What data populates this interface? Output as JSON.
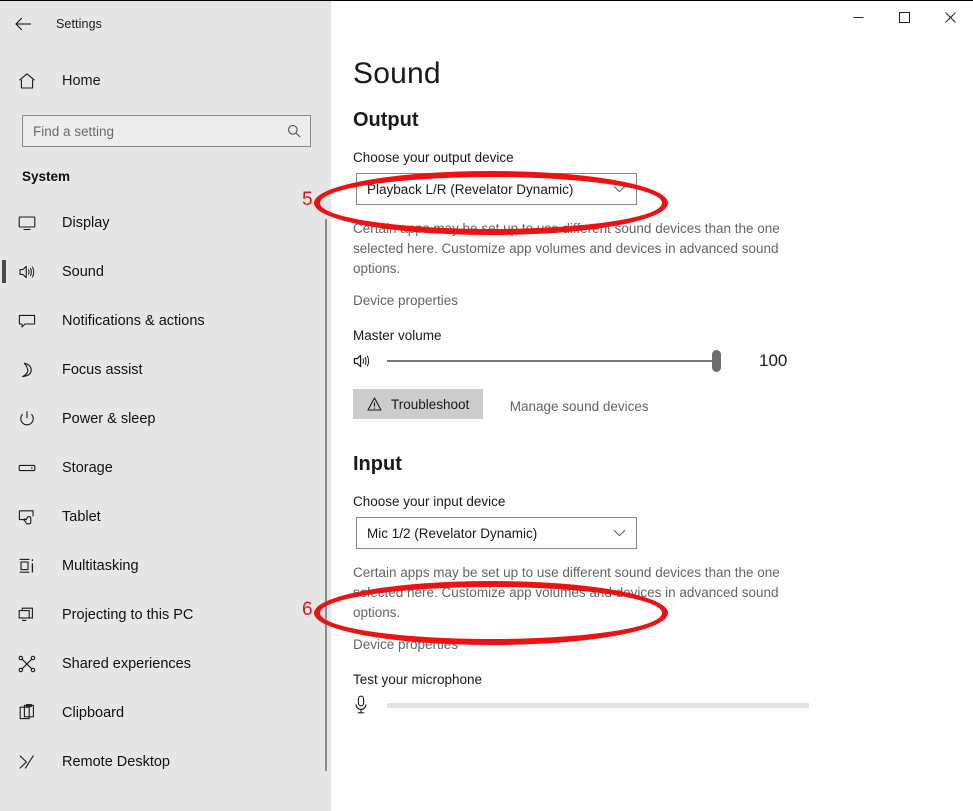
{
  "window": {
    "title": "Settings",
    "back_icon": "back-arrow-icon",
    "minimize_label": "–",
    "maximize_label": "□",
    "close_label": "×"
  },
  "sidebar": {
    "home_label": "Home",
    "home_icon": "home-icon",
    "search": {
      "placeholder": "Find a setting",
      "value": "",
      "icon": "search-icon"
    },
    "section_label": "System",
    "items": [
      {
        "label": "Display",
        "icon": "monitor-icon",
        "selected": false
      },
      {
        "label": "Sound",
        "icon": "speaker-icon",
        "selected": true
      },
      {
        "label": "Notifications & actions",
        "icon": "notification-icon",
        "selected": false
      },
      {
        "label": "Focus assist",
        "icon": "moon-icon",
        "selected": false
      },
      {
        "label": "Power & sleep",
        "icon": "power-icon",
        "selected": false
      },
      {
        "label": "Storage",
        "icon": "drive-icon",
        "selected": false
      },
      {
        "label": "Tablet",
        "icon": "tablet-icon",
        "selected": false
      },
      {
        "label": "Multitasking",
        "icon": "multitasking-icon",
        "selected": false
      },
      {
        "label": "Projecting to this PC",
        "icon": "projecting-icon",
        "selected": false
      },
      {
        "label": "Shared experiences",
        "icon": "share-icon",
        "selected": false
      },
      {
        "label": "Clipboard",
        "icon": "clipboard-icon",
        "selected": false
      },
      {
        "label": "Remote Desktop",
        "icon": "remote-desktop-icon",
        "selected": false
      }
    ]
  },
  "main": {
    "page_title": "Sound",
    "output": {
      "heading": "Output",
      "device_label": "Choose your output device",
      "device_value": "Playback L/R (Revelator Dynamic)",
      "help_text": "Certain apps may be set up to use different sound devices than the one selected here. Customize app volumes and devices in advanced sound options.",
      "device_properties_link": "Device properties",
      "volume_label": "Master volume",
      "volume_value": "100",
      "volume_icon": "speaker-icon",
      "troubleshoot_label": "Troubleshoot",
      "troubleshoot_icon": "warning-triangle-icon",
      "manage_link": "Manage sound devices"
    },
    "input": {
      "heading": "Input",
      "device_label": "Choose your input device",
      "device_value": "Mic 1/2 (Revelator Dynamic)",
      "help_text": "Certain apps may be set up to use different sound devices than the one selected here. Customize app volumes and devices in advanced sound options.",
      "device_properties_link": "Device properties",
      "test_label": "Test your microphone",
      "test_icon": "microphone-icon"
    }
  },
  "annotations": {
    "color": "#ee1111",
    "markers": [
      {
        "number": "5",
        "target": "output-device-dropdown"
      },
      {
        "number": "6",
        "target": "input-device-dropdown"
      }
    ]
  }
}
